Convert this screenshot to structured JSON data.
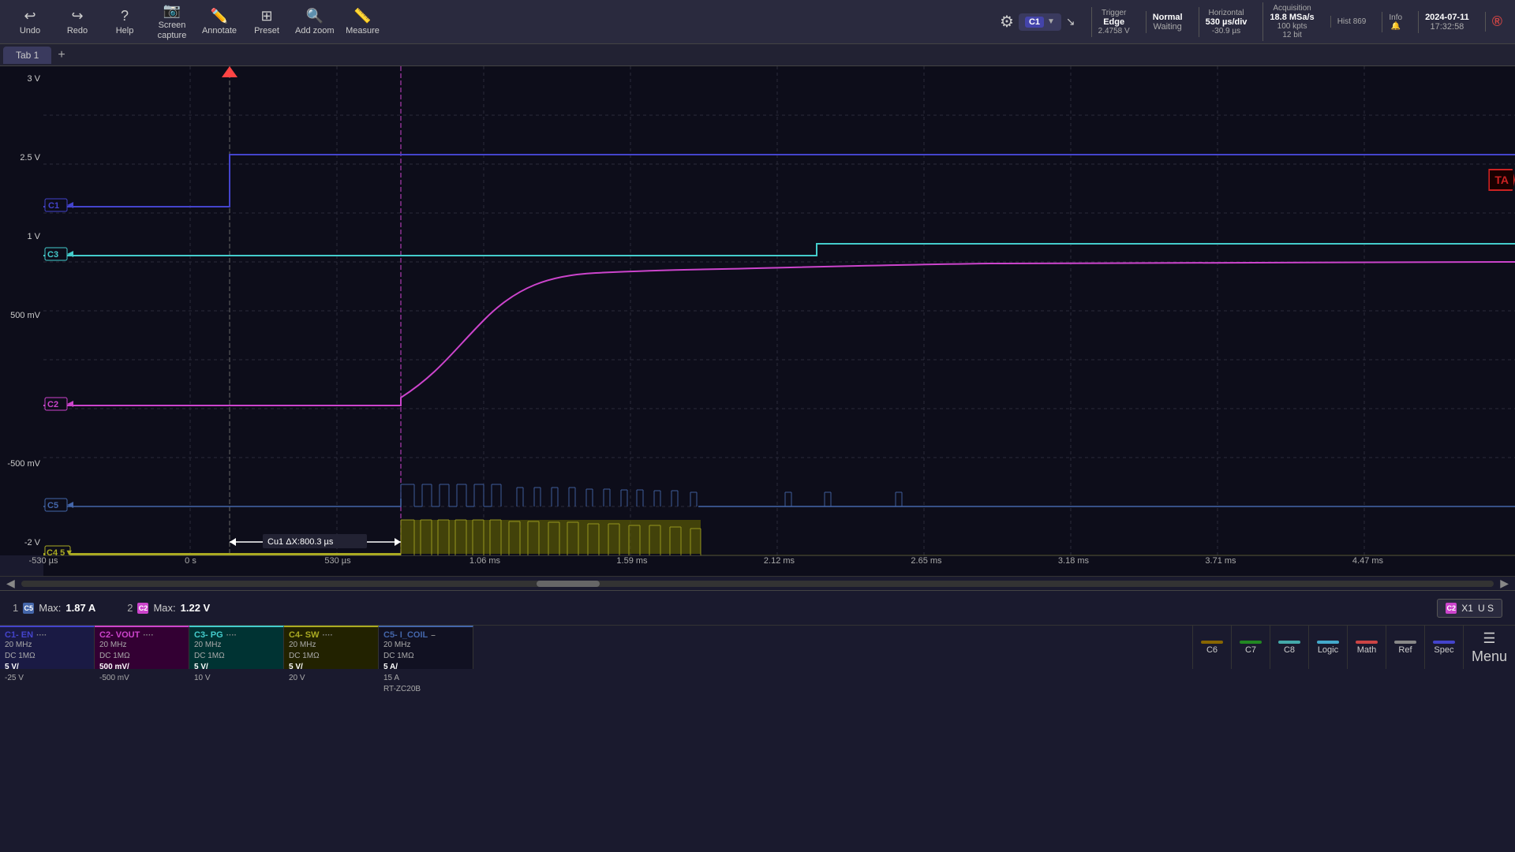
{
  "toolbar": {
    "undo_label": "Undo",
    "redo_label": "Redo",
    "help_label": "Help",
    "screen_capture_label": "Screen\ncapture",
    "annotate_label": "Annotate",
    "preset_label": "Preset",
    "add_zoom_label": "Add zoom",
    "measure_label": "Measure"
  },
  "trigger": {
    "label": "Trigger",
    "type": "Edge",
    "level": "2.4758 V",
    "mode": "Normal",
    "status": "Waiting"
  },
  "horizontal": {
    "label": "Horizontal",
    "timeDiv": "530 µs/div",
    "position": "-30.9 µs"
  },
  "acquisition": {
    "label": "Acquisition",
    "rate": "18.8 MSa/s",
    "points": "100 kpts",
    "bits": "12 bit",
    "hist": "Hist 869"
  },
  "info": {
    "label": "Info",
    "date": "2024-07-11",
    "time": "17:32:58"
  },
  "tab": {
    "name": "Tab 1"
  },
  "channel_selected": "C1",
  "ta_badge": "TA",
  "y_axis_labels": [
    "3 V",
    "2.5 V",
    "",
    "1 V",
    "500 mV",
    "",
    "-500 mV",
    "",
    "",
    "-2 V"
  ],
  "x_axis_labels": [
    "-530 µs",
    "0 s",
    "530 µs",
    "1.06 ms",
    "1.59 ms",
    "2.12 ms",
    "2.65 ms",
    "3.18 ms",
    "3.71 ms",
    "4.47 ms"
  ],
  "measurement_annotation": "Cu1 ΔX:800.3 µs",
  "measurements": [
    {
      "num": "1",
      "channel": "C5",
      "channel_color": "#4466aa",
      "label": "Max:",
      "value": "1.87 A"
    },
    {
      "num": "2",
      "channel": "C2",
      "channel_color": "#cc44cc",
      "label": "Max:",
      "value": "1.22 V"
    }
  ],
  "x1_display": {
    "badge": "C2",
    "badge_color": "#cc44cc",
    "value": "X1",
    "unit": "U S"
  },
  "channels": [
    {
      "id": "C1",
      "name": "C1- EN",
      "color": "#4444cc",
      "bg": "#1a1a66",
      "voltage": "5 V/",
      "extra1": "20 MHz",
      "extra2": "DC 1MΩ",
      "extra3": "-25 V"
    },
    {
      "id": "C2",
      "name": "C2- VOUT",
      "color": "#cc44cc",
      "bg": "#660066",
      "voltage": "500 mV/",
      "extra1": "20 MHz",
      "extra2": "DC 1MΩ",
      "extra3": "-500 mV"
    },
    {
      "id": "C3",
      "name": "C3- PG",
      "color": "#44cccc",
      "bg": "#006666",
      "voltage": "5 V/",
      "extra1": "20 MHz",
      "extra2": "DC 1MΩ",
      "extra3": "10 V"
    },
    {
      "id": "C4",
      "name": "C4- SW",
      "color": "#aaaa22",
      "bg": "#444400",
      "voltage": "5 V/",
      "extra1": "20 MHz",
      "extra2": "DC 1MΩ",
      "extra3": "20 V"
    },
    {
      "id": "C5",
      "name": "C5- I_COIL",
      "color": "#4466aa",
      "bg": "#112244",
      "voltage": "5 A/",
      "extra1": "20 MHz",
      "extra2": "DC 1MΩ",
      "extra3": "15 A",
      "extra4": "RT-ZC20B"
    }
  ],
  "bottom_buttons": [
    {
      "id": "C6",
      "label": "C6",
      "color": "#886600"
    },
    {
      "id": "C7",
      "label": "C7",
      "color": "#228822"
    },
    {
      "id": "C8",
      "label": "C8",
      "color": "#44aaaa"
    },
    {
      "id": "Logic",
      "label": "Logic",
      "color": "#44aacc"
    },
    {
      "id": "Math",
      "label": "Math",
      "color": "#cc4444"
    },
    {
      "id": "Ref",
      "label": "Ref",
      "color": "#888888"
    },
    {
      "id": "Spec",
      "label": "Spec",
      "color": "#4444cc"
    },
    {
      "id": "Menu",
      "label": "Menu",
      "color": ""
    }
  ]
}
